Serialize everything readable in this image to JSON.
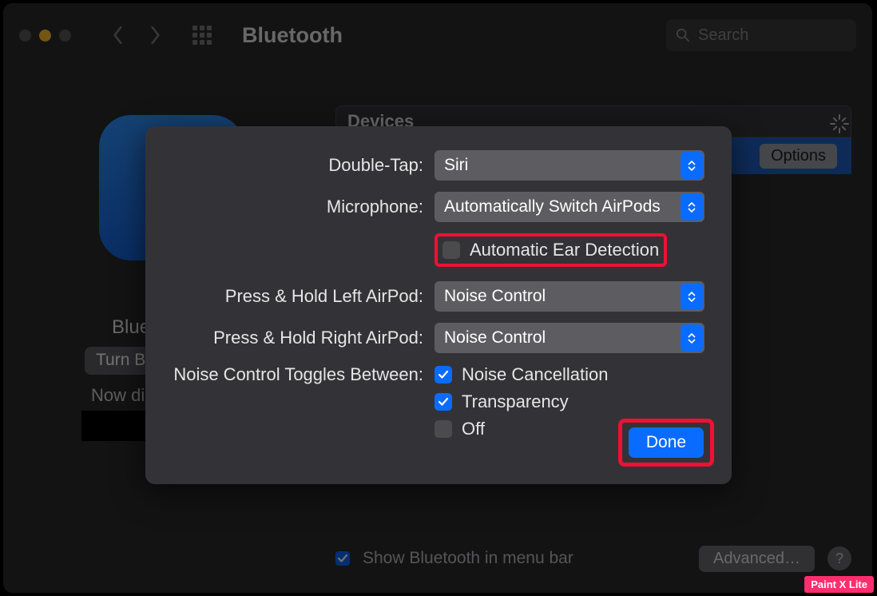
{
  "toolbar": {
    "title": "Bluetooth",
    "search_placeholder": "Search"
  },
  "background": {
    "devices_header": "Devices",
    "options_button": "Options",
    "bluetooth_label": "Blue",
    "turn_off_label": "Turn B",
    "now_discoverable": "Now di",
    "show_in_menubar": "Show Bluetooth in menu bar",
    "advanced_button": "Advanced…",
    "help_button": "?"
  },
  "modal": {
    "labels": {
      "double_tap": "Double-Tap:",
      "microphone": "Microphone:",
      "ear_detection": "Automatic Ear Detection",
      "press_left": "Press & Hold Left AirPod:",
      "press_right": "Press & Hold Right AirPod:",
      "noise_toggles": "Noise Control Toggles Between:"
    },
    "values": {
      "double_tap": "Siri",
      "microphone": "Automatically Switch AirPods",
      "press_left": "Noise Control",
      "press_right": "Noise Control"
    },
    "noise_options": {
      "cancellation": "Noise Cancellation",
      "transparency": "Transparency",
      "off": "Off"
    },
    "noise_checked": {
      "cancellation": true,
      "transparency": true,
      "off": false
    },
    "ear_detection_checked": false,
    "done_button": "Done"
  },
  "watermark": "Paint X Lite"
}
